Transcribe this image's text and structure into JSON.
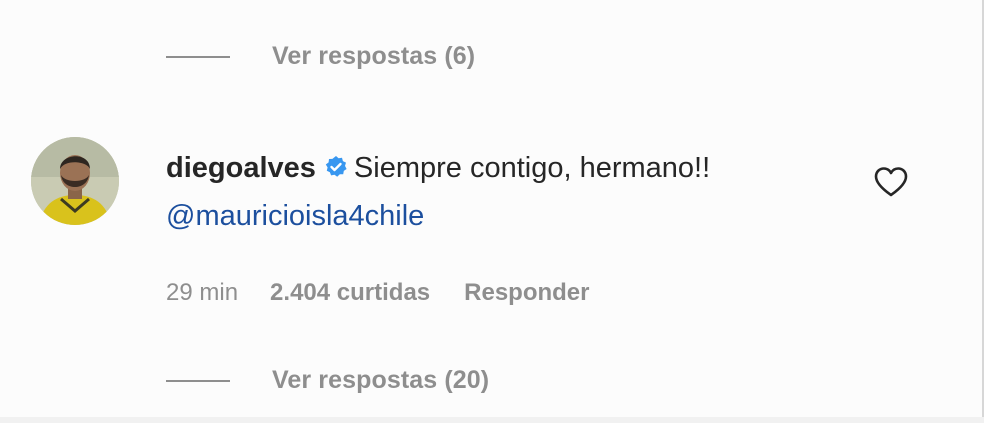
{
  "replies_top": {
    "label": "Ver respostas (6)"
  },
  "comment": {
    "username": "diegoalves",
    "verified_icon": "verified-badge-icon",
    "text": "Siempre contigo, hermano!! ",
    "mention": "@mauricioisla4chile",
    "time": "29 min",
    "likes": "2.404 curtidas",
    "reply": "Responder",
    "like_icon": "heart-outline-icon"
  },
  "replies_bottom": {
    "label": "Ver respostas (20)"
  },
  "colors": {
    "text": "#262626",
    "secondary": "#8e8e8e",
    "mention": "#1c4f9e",
    "verified": "#3897f0"
  }
}
